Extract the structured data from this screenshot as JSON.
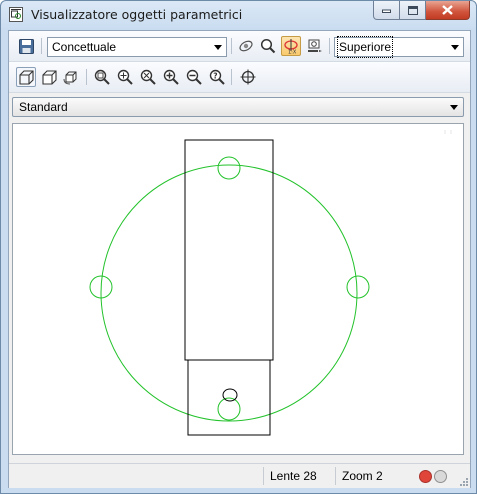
{
  "window": {
    "title": "Visualizzatore oggetti parametrici"
  },
  "toolbar": {
    "visual_style_value": "Concettuale",
    "view_value": "Superiore"
  },
  "style_selector": {
    "value": "Standard"
  },
  "statusbar": {
    "lens": "Lente 28",
    "zoom": "Zoom 2"
  },
  "colors": {
    "accent_red": "#e0453a",
    "accent_gray": "#d9d9d9",
    "drawing_green": "#22c22a",
    "drawing_black": "#000000"
  }
}
